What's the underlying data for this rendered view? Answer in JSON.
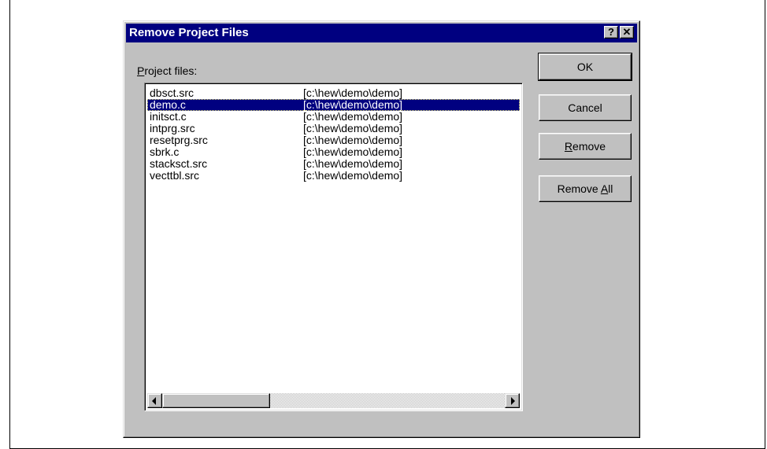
{
  "window": {
    "title": "Remove Project Files",
    "help_glyph": "?",
    "close_glyph": "✕"
  },
  "list": {
    "label_prefix": "",
    "label_mnemonic": "P",
    "label_rest": "roject files:",
    "selected_index": 1,
    "items": [
      {
        "name": "dbsct.src",
        "path": "[c:\\hew\\demo\\demo]"
      },
      {
        "name": "demo.c",
        "path": "[c:\\hew\\demo\\demo]"
      },
      {
        "name": "initsct.c",
        "path": "[c:\\hew\\demo\\demo]"
      },
      {
        "name": "intprg.src",
        "path": "[c:\\hew\\demo\\demo]"
      },
      {
        "name": "resetprg.src",
        "path": "[c:\\hew\\demo\\demo]"
      },
      {
        "name": "sbrk.c",
        "path": "[c:\\hew\\demo\\demo]"
      },
      {
        "name": "stacksct.src",
        "path": "[c:\\hew\\demo\\demo]"
      },
      {
        "name": "vecttbl.src",
        "path": "[c:\\hew\\demo\\demo]"
      }
    ]
  },
  "buttons": {
    "ok": "OK",
    "cancel": "Cancel",
    "remove_mnemonic": "R",
    "remove_rest": "emove",
    "remove_all_prefix": "Remove ",
    "remove_all_mnemonic": "A",
    "remove_all_rest": "ll"
  },
  "icons": {
    "help": "help-icon",
    "close": "close-icon",
    "scroll_left": "arrow-left-icon",
    "scroll_right": "arrow-right-icon"
  },
  "colors": {
    "titlebar": "#000080",
    "selection": "#000080",
    "face": "#c0c0c0"
  }
}
